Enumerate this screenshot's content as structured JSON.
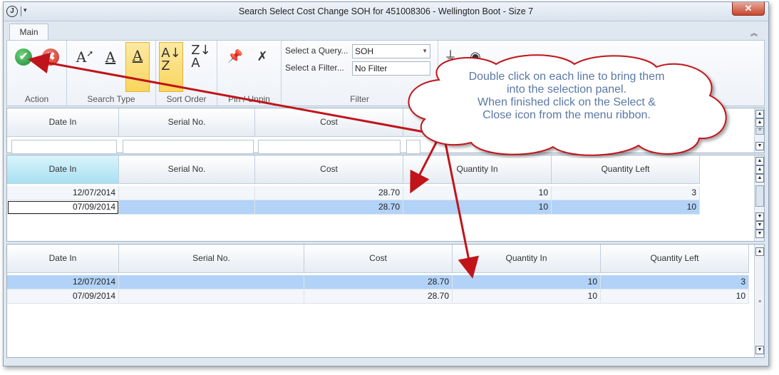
{
  "window": {
    "title": "Search Select Cost Change SOH for 451008306 - Wellington Boot - Size 7",
    "close_symbol": "✕"
  },
  "tabs": [
    {
      "label": "Main"
    }
  ],
  "ribbon": {
    "groups": {
      "action": "Action",
      "search_type": "Search Type",
      "sort_order": "Sort Order",
      "pin_unpin": "Pin / Unpin",
      "filter": "Filter"
    },
    "query_label": "Select a Query...",
    "query_value": "SOH",
    "filter_label": "Select a Filter...",
    "filter_value": "No Filter"
  },
  "callout": {
    "line1": "Double click on each line to bring them",
    "line2": "into the selection panel.",
    "line3": "When finished click on the Select &",
    "line4": "Close icon from the menu ribbon."
  },
  "search_grid": {
    "columns": [
      "Date In",
      "Serial No.",
      "Cost"
    ]
  },
  "results_grid": {
    "columns": [
      "Date In",
      "Serial No.",
      "Cost",
      "Quantity In",
      "Quantity Left"
    ],
    "rows": [
      [
        "12/07/2014",
        "",
        "28.70",
        "10",
        "3"
      ],
      [
        "07/09/2014",
        "",
        "28.70",
        "10",
        "10"
      ]
    ]
  },
  "selection_grid": {
    "columns": [
      "Date In",
      "Serial No.",
      "Cost",
      "Quantity In",
      "Quantity Left"
    ],
    "rows": [
      [
        "12/07/2014",
        "",
        "28.70",
        "10",
        "3"
      ],
      [
        "07/09/2014",
        "",
        "28.70",
        "10",
        "10"
      ]
    ]
  },
  "colors": {
    "accent_select": "#b2d3f7",
    "arrow": "#c0141a",
    "callout_text": "#5a78a5"
  }
}
